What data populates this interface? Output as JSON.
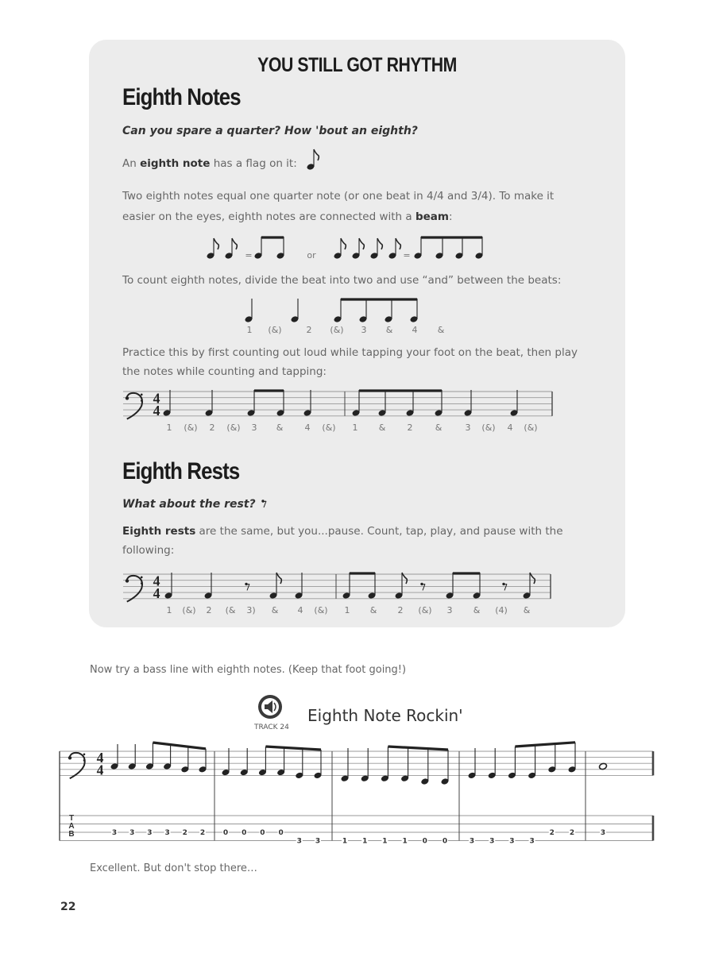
{
  "box": {
    "title": "YOU STILL GOT RHYTHM",
    "eighth_notes": {
      "heading": "Eighth Notes",
      "subheading": "Can you spare a quarter? How 'bout an eighth?",
      "flag_line": {
        "prefix": "An ",
        "bold": "eighth note",
        "suffix": " has a flag on it:"
      },
      "beam_paragraph": {
        "text": "Two eighth notes equal one quarter note (or one beat in 4/4 and 3/4). To make it easier on the eyes, eighth notes are connected with a ",
        "bold": "beam",
        "suffix": ":"
      },
      "equivalence": {
        "or_label": "or",
        "equals_label": "="
      },
      "count_intro": "To count eighth notes, divide the beat into two and use “and” between the beats:",
      "count_example": {
        "notes": [
          "quarter",
          "quarter",
          "eighth-beamed",
          "eighth-beamed",
          "eighth-beamed",
          "eighth-beamed"
        ],
        "counts": [
          "1",
          "(&)",
          "2",
          "(&)",
          "3",
          "&",
          "4",
          "&"
        ]
      },
      "practice_text": "Practice this by first counting out loud while tapping your foot on the beat, then play the notes while counting and tapping:",
      "exercise": {
        "clef": "bass",
        "time_signature": "4/4",
        "measures": [
          [
            "q",
            "q",
            "e-beam-start",
            "e-beam-end",
            "q"
          ],
          [
            "e-beam-start",
            "e",
            "e",
            "e-beam-end",
            "q",
            "q"
          ]
        ],
        "counts": [
          "1",
          "(&)",
          "2",
          "(&)",
          "3",
          "&",
          "4",
          "(&)",
          "1",
          "&",
          "2",
          "&",
          "3",
          "(&)",
          "4",
          "(&)"
        ]
      }
    },
    "eighth_rests": {
      "heading": "Eighth Rests",
      "subheading": "What about the rest?",
      "paragraph": {
        "bold": "Eighth rests",
        "text": " are the same, but you...pause. Count, tap, play, and pause with the following:"
      },
      "exercise": {
        "clef": "bass",
        "time_signature": "4/4",
        "measures": [
          [
            "q",
            "q",
            "rest-e",
            "e-flag",
            "q"
          ],
          [
            "e-beam-start",
            "e-beam-end",
            "e-flag",
            "rest-e",
            "e-beam-start",
            "e-beam-end",
            "rest-e",
            "e-flag"
          ]
        ],
        "counts": [
          "1",
          "(&)",
          "2",
          "(&",
          "3)",
          "&",
          "4",
          "(&)",
          "1",
          "&",
          "2",
          "(&)",
          "3",
          "&",
          "(4)",
          "&"
        ]
      }
    }
  },
  "intro_text": "Now try a bass line with eighth notes. (Keep that foot going!)",
  "song": {
    "track_label": "TRACK 24",
    "title": "Eighth Note Rockin'",
    "clef": "bass",
    "time_signature": "4/4",
    "tab_label": [
      "T",
      "A",
      "B"
    ],
    "measures": [
      {
        "notes": [
          "C3",
          "C3",
          "C3",
          "C3",
          "B2",
          "B2"
        ],
        "durations": [
          "q",
          "q",
          "e",
          "e",
          "e",
          "e"
        ],
        "tab": [
          {
            "string": 3,
            "fret": "3"
          },
          {
            "string": 3,
            "fret": "3"
          },
          {
            "string": 3,
            "fret": "3"
          },
          {
            "string": 3,
            "fret": "3"
          },
          {
            "string": 3,
            "fret": "2"
          },
          {
            "string": 3,
            "fret": "2"
          }
        ]
      },
      {
        "notes": [
          "A2",
          "A2",
          "A2",
          "A2",
          "G2",
          "G2"
        ],
        "durations": [
          "q",
          "q",
          "e",
          "e",
          "e",
          "e"
        ],
        "tab": [
          {
            "string": 3,
            "fret": "0"
          },
          {
            "string": 3,
            "fret": "0"
          },
          {
            "string": 3,
            "fret": "0"
          },
          {
            "string": 3,
            "fret": "0"
          },
          {
            "string": 4,
            "fret": "3"
          },
          {
            "string": 4,
            "fret": "3"
          }
        ]
      },
      {
        "notes": [
          "F2",
          "F2",
          "F2",
          "F2",
          "E2",
          "E2"
        ],
        "durations": [
          "q",
          "q",
          "e",
          "e",
          "e",
          "e"
        ],
        "tab": [
          {
            "string": 4,
            "fret": "1"
          },
          {
            "string": 4,
            "fret": "1"
          },
          {
            "string": 4,
            "fret": "1"
          },
          {
            "string": 4,
            "fret": "1"
          },
          {
            "string": 4,
            "fret": "0"
          },
          {
            "string": 4,
            "fret": "0"
          }
        ]
      },
      {
        "notes": [
          "G2",
          "G2",
          "G2",
          "G2",
          "B2",
          "B2"
        ],
        "durations": [
          "q",
          "q",
          "e",
          "e",
          "e",
          "e"
        ],
        "tab": [
          {
            "string": 4,
            "fret": "3"
          },
          {
            "string": 4,
            "fret": "3"
          },
          {
            "string": 4,
            "fret": "3"
          },
          {
            "string": 4,
            "fret": "3"
          },
          {
            "string": 3,
            "fret": "2"
          },
          {
            "string": 3,
            "fret": "2"
          }
        ]
      },
      {
        "notes": [
          "C3"
        ],
        "durations": [
          "w"
        ],
        "tab": [
          {
            "string": 3,
            "fret": "3"
          }
        ]
      }
    ]
  },
  "outro_text": "Excellent. But don't stop there…",
  "page_number": "22"
}
